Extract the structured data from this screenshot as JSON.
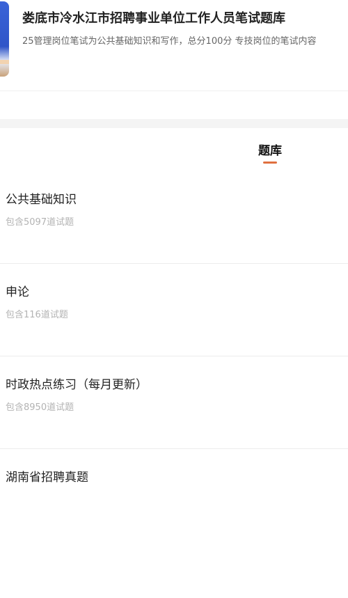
{
  "header": {
    "title": "娄底市冷水江市招聘事业单位工作人员笔试题库",
    "subtitle": "25管理岗位笔试为公共基础知识和写作，总分100分 专技岗位的笔试内容"
  },
  "tabs": [
    {
      "label": "题库",
      "active": true
    }
  ],
  "colors": {
    "accent": "#e0703f",
    "muted_text": "#b3b3b3",
    "cover_blue": "#3a63d8"
  },
  "sections": [
    {
      "title": "公共基础知识",
      "count": "包含5097道试题"
    },
    {
      "title": "申论",
      "count": "包含116道试题"
    },
    {
      "title": "时政热点练习（每月更新）",
      "count": "包含8950道试题"
    },
    {
      "title": "湖南省招聘真题",
      "count": ""
    }
  ]
}
